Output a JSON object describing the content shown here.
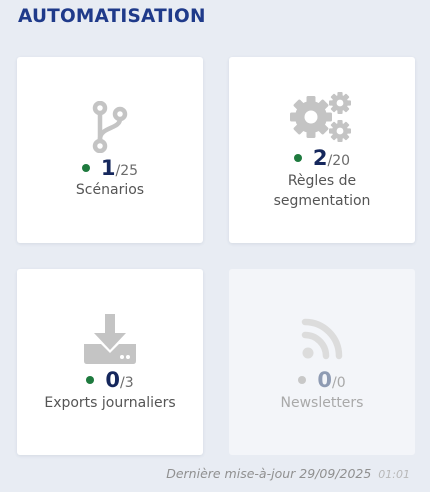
{
  "section": {
    "title": "AUTOMATISATION"
  },
  "cards": [
    {
      "icon": "branch-icon",
      "count": "1",
      "total": "/25",
      "label_lines": [
        "Scénarios"
      ],
      "status_color": "#1e7a3e",
      "enabled": true
    },
    {
      "icon": "gears-icon",
      "count": "2",
      "total": "/20",
      "label_lines": [
        "Règles de",
        "segmentation"
      ],
      "status_color": "#1e7a3e",
      "enabled": true
    },
    {
      "icon": "download-icon",
      "count": "0",
      "total": "/3",
      "label_lines": [
        "Exports journaliers"
      ],
      "status_color": "#1e7a3e",
      "enabled": true
    },
    {
      "icon": "rss-icon",
      "count": "0",
      "total": "/0",
      "label_lines": [
        "Newsletters"
      ],
      "status_color": "#c8c8c8",
      "enabled": false
    }
  ],
  "footer": {
    "label": "Dernière mise-à-jour",
    "date": "29/09/2025",
    "time": "01:01"
  },
  "colors": {
    "title": "#1f3a8a",
    "count": "#15275c",
    "icon": "#c4c4c4",
    "icon_disabled": "#dcdcdc",
    "background": "#e8ecf3"
  }
}
